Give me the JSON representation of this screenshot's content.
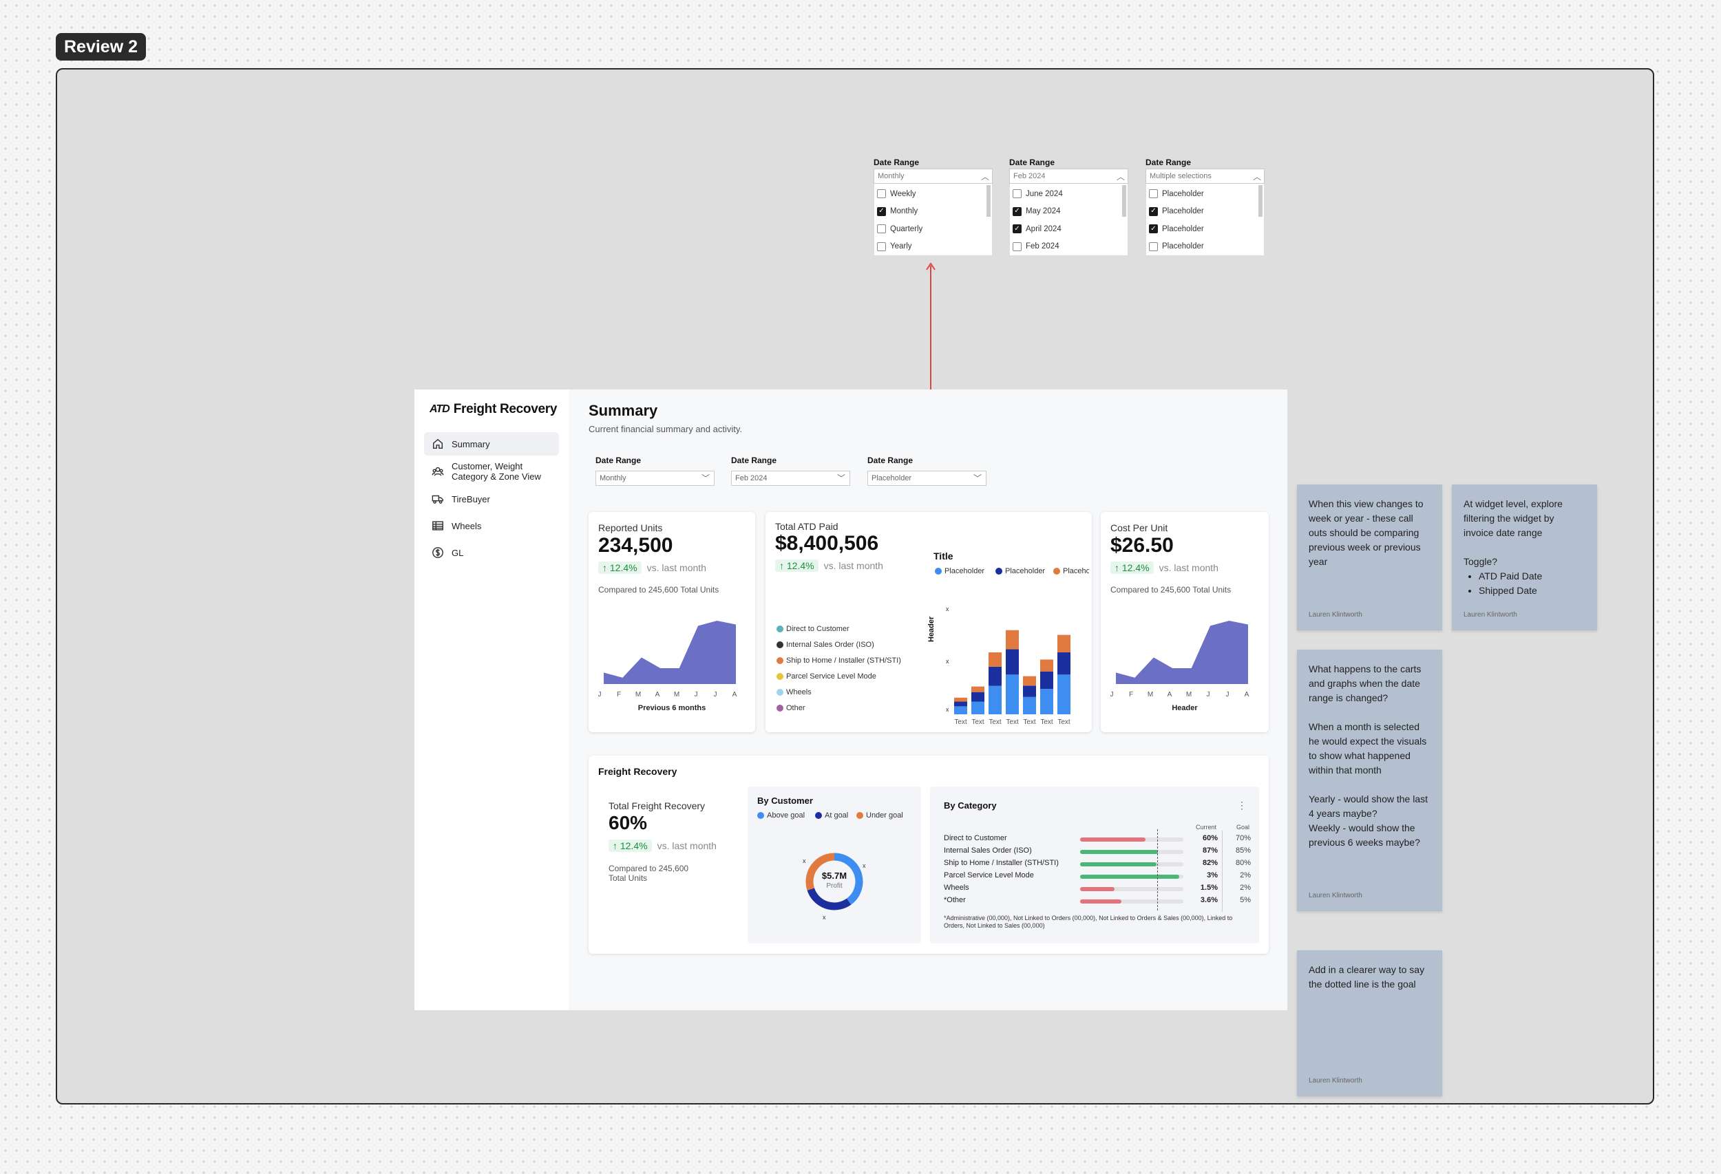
{
  "review_label": "Review 2",
  "popups": [
    {
      "label": "Date Range",
      "value": "Monthly",
      "options": [
        {
          "text": "Weekly",
          "checked": false
        },
        {
          "text": "Monthly",
          "checked": true
        },
        {
          "text": "Quarterly",
          "checked": false
        },
        {
          "text": "Yearly",
          "checked": false
        }
      ]
    },
    {
      "label": "Date Range",
      "value": "Feb 2024",
      "options": [
        {
          "text": "June 2024",
          "checked": false
        },
        {
          "text": "May 2024",
          "checked": true
        },
        {
          "text": "April 2024",
          "checked": true
        },
        {
          "text": "Feb 2024",
          "checked": false
        }
      ]
    },
    {
      "label": "Date Range",
      "value": "Multiple selections",
      "options": [
        {
          "text": "Placeholder",
          "checked": false
        },
        {
          "text": "Placeholder",
          "checked": true
        },
        {
          "text": "Placeholder",
          "checked": true
        },
        {
          "text": "Placeholder",
          "checked": false
        }
      ]
    }
  ],
  "app": {
    "logo_mark": "ATD",
    "logo_text": "Freight Recovery",
    "nav": [
      {
        "label": "Summary",
        "icon": "home-icon",
        "active": true
      },
      {
        "label": "Customer, Weight Category & Zone View",
        "icon": "users-icon",
        "active": false
      },
      {
        "label": "TireBuyer",
        "icon": "truck-icon",
        "active": false
      },
      {
        "label": "Wheels",
        "icon": "table-icon",
        "active": false
      },
      {
        "label": "GL",
        "icon": "dollar-icon",
        "active": false
      }
    ],
    "title": "Summary",
    "subtitle": "Current financial summary and activity.",
    "filters": [
      {
        "label": "Date Range",
        "value": "Monthly"
      },
      {
        "label": "Date Range",
        "value": "Feb 2024"
      },
      {
        "label": "Date Range",
        "value": "Placeholder"
      }
    ],
    "kpi_units": {
      "title": "Reported Units",
      "value": "234,500",
      "change": "12.4%",
      "vs": "vs. last month",
      "compare": "Compared to 245,600 Total Units",
      "caption": "Previous 6 months"
    },
    "kpi_paid": {
      "title": "Total ATD Paid",
      "value": "$8,400,506",
      "change": "12.4%",
      "vs": "vs. last month"
    },
    "kpi_cost": {
      "title": "Cost Per Unit",
      "value": "$26.50",
      "change": "12.4%",
      "vs": "vs. last month",
      "compare": "Compared to 245,600 Total Units",
      "caption": "Header"
    },
    "channel_legend": [
      {
        "label": "Direct to Customer",
        "color": "#5ab3b8"
      },
      {
        "label": "Internal Sales Order (ISO)",
        "color": "#333333"
      },
      {
        "label": "Ship to Home / Installer (STH/STI)",
        "color": "#e07a3e"
      },
      {
        "label": "Parcel Service Level Mode",
        "color": "#e6c33a"
      },
      {
        "label": "Wheels",
        "color": "#9fd3ee"
      },
      {
        "label": "Other",
        "color": "#a0649e"
      }
    ],
    "freight": {
      "section_title": "Freight Recovery",
      "total_title": "Total Freight Recovery",
      "total_value": "60%",
      "change": "12.4%",
      "vs": "vs. last month",
      "compare": "Compared to 245,600 Total Units",
      "by_customer_title": "By Customer",
      "customer_legend": [
        {
          "label": "Above goal",
          "color": "#3d8ef0"
        },
        {
          "label": "At goal",
          "color": "#1c2f9e"
        },
        {
          "label": "Under goal",
          "color": "#e07a3e"
        }
      ],
      "donut_value": "$5.7M",
      "donut_label": "Profit",
      "donut_marks": [
        "x",
        "x",
        "x"
      ],
      "by_category_title": "By Category",
      "col_current": "Current",
      "col_goal": "Goal",
      "categories": [
        {
          "name": "Direct to Customer",
          "current": "60%",
          "goal": "70%",
          "fill": 0.63,
          "color": "#e5737c"
        },
        {
          "name": "Internal Sales Order (ISO)",
          "current": "87%",
          "goal": "85%",
          "fill": 0.75,
          "color": "#4bb57a"
        },
        {
          "name": "Ship to Home / Installer (STH/STI)",
          "current": "82%",
          "goal": "80%",
          "fill": 0.74,
          "color": "#4bb57a"
        },
        {
          "name": "Parcel Service Level Mode",
          "current": "3%",
          "goal": "2%",
          "fill": 0.96,
          "color": "#4bb57a"
        },
        {
          "name": "Wheels",
          "current": "1.5%",
          "goal": "2%",
          "fill": 0.33,
          "color": "#e5737c"
        },
        {
          "name": "*Other",
          "current": "3.6%",
          "goal": "5%",
          "fill": 0.4,
          "color": "#e5737c"
        }
      ],
      "footnote": "*Administrative (00,000), Not Linked to Orders (00,000), Not Linked to Orders & Sales (00,000), Linked to Orders, Not Linked to Sales (00,000)"
    }
  },
  "notes": [
    {
      "text": "When this view changes to week or year - these call outs should be comparing previous week or previous year",
      "author": "Lauren Klintworth"
    },
    {
      "text": "At widget level, explore filtering the widget by invoice date range",
      "extra": "Toggle?",
      "bullets": [
        "ATD Paid Date",
        "Shipped Date"
      ],
      "author": "Lauren Klintworth"
    },
    {
      "p1": "What happens to the carts and graphs when the date range is changed?",
      "p2": "When a month is selected he would expect the visuals to show what happened within that month",
      "p3": "Yearly - would show the last 4 years maybe?",
      "p4": "Weekly - would show the previous 6 weeks maybe?",
      "author": "Lauren Klintworth"
    },
    {
      "text": "Add in a clearer way to say the dotted line is the goal",
      "author": "Lauren Klintworth"
    }
  ],
  "chart_data": [
    {
      "type": "area",
      "categories": [
        "J",
        "F",
        "M",
        "A",
        "M",
        "J",
        "J",
        "A"
      ],
      "values": [
        18,
        10,
        42,
        25,
        25,
        92,
        100,
        94
      ],
      "xlabel": "Previous 6 months",
      "color": "#6b6fc6"
    },
    {
      "type": "bar",
      "stacked": true,
      "title": "Title",
      "ylabel": "Header",
      "yticks": [
        "x",
        "x",
        "x"
      ],
      "categories": [
        "Text",
        "Text",
        "Text",
        "Text",
        "Text",
        "Text",
        "Text"
      ],
      "series": [
        {
          "name": "Placeholder",
          "color": "#3d8ef0",
          "values": [
            10,
            16,
            36,
            50,
            22,
            32,
            50
          ]
        },
        {
          "name": "Placeholder",
          "color": "#1c2f9e",
          "values": [
            6,
            12,
            24,
            32,
            14,
            22,
            28
          ]
        },
        {
          "name": "Placeholder",
          "color": "#e07a3e",
          "values": [
            5,
            7,
            18,
            24,
            12,
            15,
            22
          ]
        }
      ]
    },
    {
      "type": "area",
      "categories": [
        "J",
        "F",
        "M",
        "A",
        "M",
        "J",
        "J",
        "A"
      ],
      "values": [
        18,
        10,
        42,
        25,
        25,
        92,
        100,
        94
      ],
      "xlabel": "Header",
      "color": "#6b6fc6"
    },
    {
      "type": "pie",
      "donut": true,
      "labels": [
        "Above goal",
        "At goal",
        "Under goal"
      ],
      "values": [
        40,
        30,
        30
      ],
      "colors": [
        "#3d8ef0",
        "#1c2f9e",
        "#e07a3e"
      ]
    }
  ]
}
